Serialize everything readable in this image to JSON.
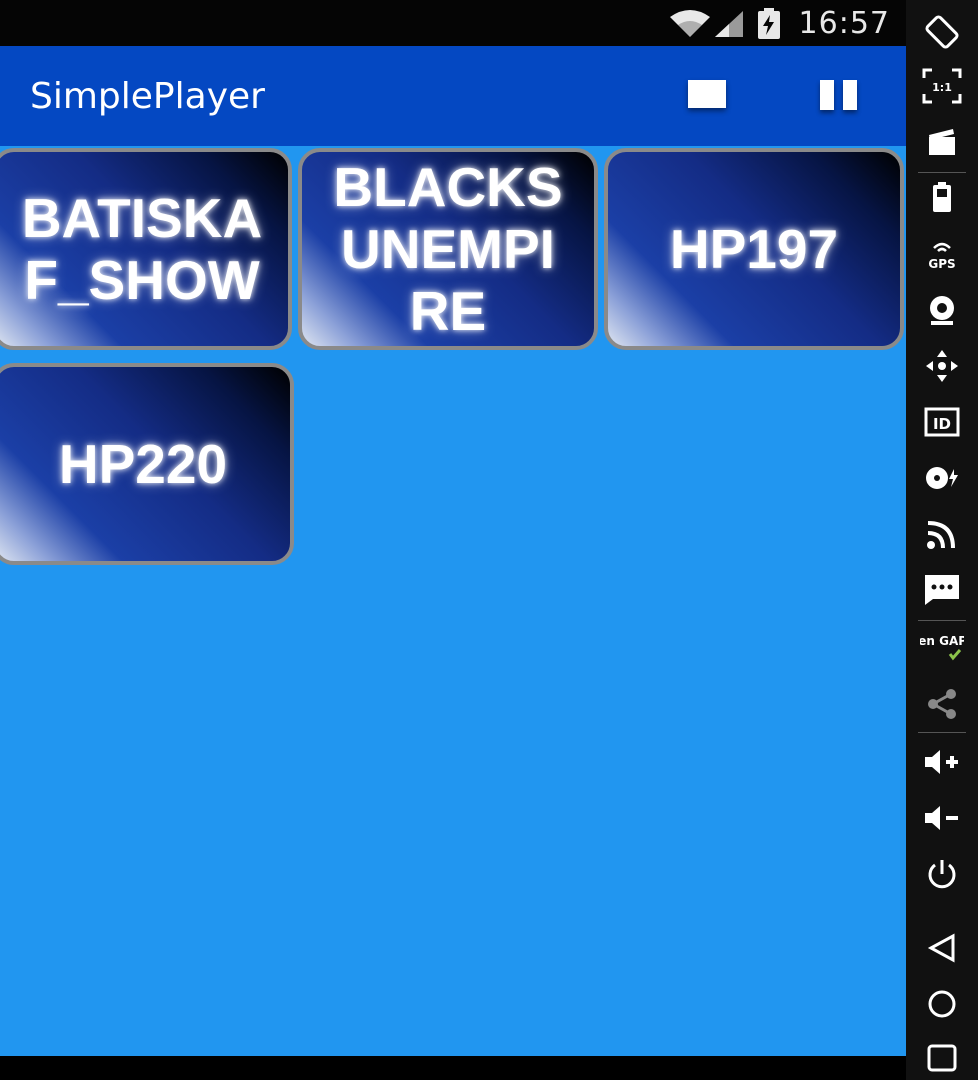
{
  "status_bar": {
    "time": "16:57"
  },
  "app_bar": {
    "title": "SimplePlayer"
  },
  "tiles": [
    {
      "label": "BATISKA\nF_SHOW"
    },
    {
      "label": "BLACKS\nUNEMPI\nRE"
    },
    {
      "label": "HP197"
    },
    {
      "label": "HP220"
    }
  ],
  "toolbar": {
    "gps_label": "GPS",
    "id_label": "ID",
    "opengapps_label": "Open GAPPS",
    "scale_label": "1:1"
  },
  "colors": {
    "appbar": "#0448c2",
    "content_background": "#2196f0",
    "tile_border": "#8a8a8a"
  }
}
